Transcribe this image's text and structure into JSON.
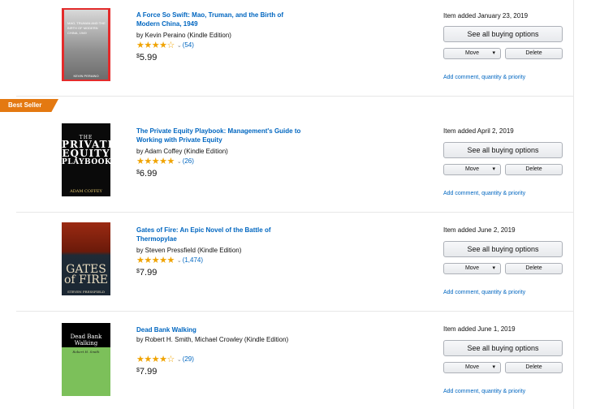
{
  "items": [
    {
      "best_seller": false,
      "title": "A Force So Swift: Mao, Truman, and the Birth of Modern China, 1949",
      "author": "by Kevin Peraino (Kindle Edition)",
      "stars": "★★★★☆",
      "rating_count": "(54)",
      "price_symbol": "$",
      "price": "5.99",
      "added": "Item added January 23, 2019",
      "cover_text": "MAO, TRUMAN AND THE BIRTH OF MODERN CHINA, 1949",
      "cover_author": "KEVIN PERAINO"
    },
    {
      "best_seller": true,
      "badge": "Best Seller",
      "title": "The Private Equity Playbook: Management's Guide to Working with Private Equity",
      "author": "by Adam Coffey (Kindle Edition)",
      "stars": "★★★★★",
      "rating_count": "(26)",
      "price_symbol": "$",
      "price": "6.99",
      "added": "Item added April 2, 2019",
      "cover_line1": "THE",
      "cover_line2": "PRIVATE",
      "cover_line3": "EQUITY",
      "cover_line4": "PLAYBOOK",
      "cover_author": "ADAM COFFEY"
    },
    {
      "best_seller": false,
      "title": "Gates of Fire: An Epic Novel of the Battle of Thermopylae",
      "author": "by Steven Pressfield (Kindle Edition)",
      "stars": "★★★★★",
      "rating_count": "(1,474)",
      "price_symbol": "$",
      "price": "7.99",
      "added": "Item added June 2, 2019",
      "cover_line1": "GATES",
      "cover_line2": "of FIRE",
      "cover_author": "STEVEN PRESSFIELD"
    },
    {
      "best_seller": false,
      "title": "Dead Bank Walking",
      "author": "by Robert H. Smith, Michael Crowley (Kindle Edition)",
      "stars": "★★★★☆",
      "rating_count": "(29)",
      "price_symbol": "$",
      "price": "7.99",
      "added": "Item added June 1, 2019",
      "cover_line1": "Dead Bank",
      "cover_line2": "Walking",
      "cover_author": "Robert H. Smith"
    }
  ],
  "buttons": {
    "buy": "See all buying options",
    "move": "Move",
    "delete": "Delete",
    "add_comment": "Add comment, quantity & priority",
    "dropdown": "▾",
    "chevron": "⌄"
  },
  "colors": {
    "link": "#0066c0",
    "star": "#f0a300",
    "badge": "#e47911"
  }
}
